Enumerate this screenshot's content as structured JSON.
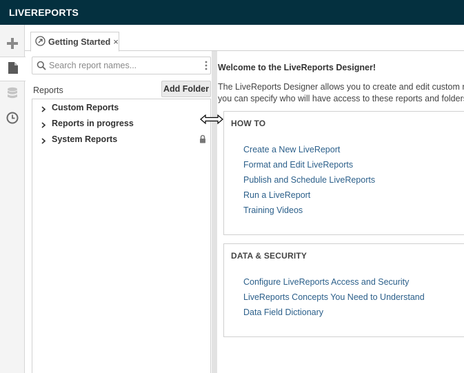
{
  "app": {
    "title": "LIVEREPORTS"
  },
  "rail": {
    "items": [
      {
        "icon": "plus-icon"
      },
      {
        "icon": "document-icon"
      },
      {
        "icon": "database-icon"
      },
      {
        "icon": "clock-icon"
      }
    ]
  },
  "tabs": [
    {
      "label": "Getting Started",
      "close": "×",
      "icon": "getting-started-icon"
    }
  ],
  "sidebar": {
    "search_placeholder": "Search report names...",
    "reports_label": "Reports",
    "add_folder_label": "Add Folder",
    "tree": [
      {
        "label": "Custom Reports",
        "locked": false
      },
      {
        "label": "Reports in progress",
        "locked": false
      },
      {
        "label": "System Reports",
        "locked": true
      }
    ]
  },
  "main": {
    "welcome": "Welcome to the LiveReports Designer!",
    "intro_line1": "The LiveReports Designer allows you to create and edit custom repo",
    "intro_line2": "you can specify who will have access to these reports and folders.",
    "sections": [
      {
        "title": "HOW TO",
        "links": [
          "Create a New LiveReport",
          "Format and Edit LiveReports",
          "Publish and Schedule LiveReports",
          "Run a LiveReport",
          "Training Videos"
        ]
      },
      {
        "title": "DATA & SECURITY",
        "links": [
          "Configure LiveReports Access and Security",
          "LiveReports Concepts You Need to Understand",
          "Data Field Dictionary"
        ]
      }
    ]
  },
  "colors": {
    "topbar": "#04303f",
    "link": "#2b5f8a",
    "rail_bg": "#f4f4f4"
  }
}
